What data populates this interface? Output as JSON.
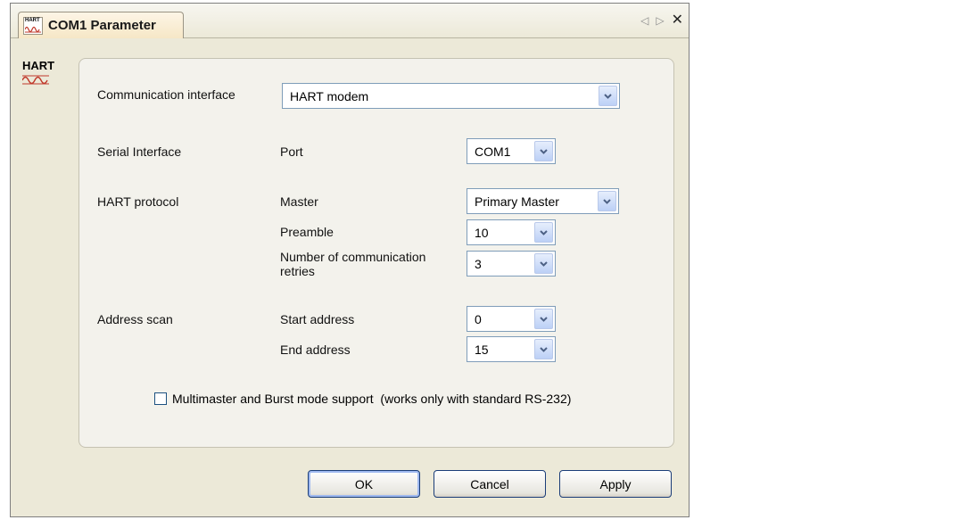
{
  "window": {
    "tab_title": "COM1 Parameter",
    "tab_icon_text": "HART"
  },
  "side_logo": {
    "text": "HART"
  },
  "form": {
    "communication_interface": {
      "label": "Communication interface",
      "value": "HART modem"
    },
    "serial_interface": {
      "section": "Serial Interface",
      "port_label": "Port",
      "port_value": "COM1"
    },
    "hart_protocol": {
      "section": "HART protocol",
      "master_label": "Master",
      "master_value": "Primary Master",
      "preamble_label": "Preamble",
      "preamble_value": "10",
      "retries_label": "Number of communication retries",
      "retries_value": "3"
    },
    "address_scan": {
      "section": "Address scan",
      "start_label": "Start address",
      "start_value": "0",
      "end_label": "End address",
      "end_value": "15"
    },
    "multimaster": {
      "label": "Multimaster and Burst mode support  (works only with standard RS-232)",
      "checked": false
    }
  },
  "buttons": {
    "ok": "OK",
    "cancel": "Cancel",
    "apply": "Apply"
  }
}
